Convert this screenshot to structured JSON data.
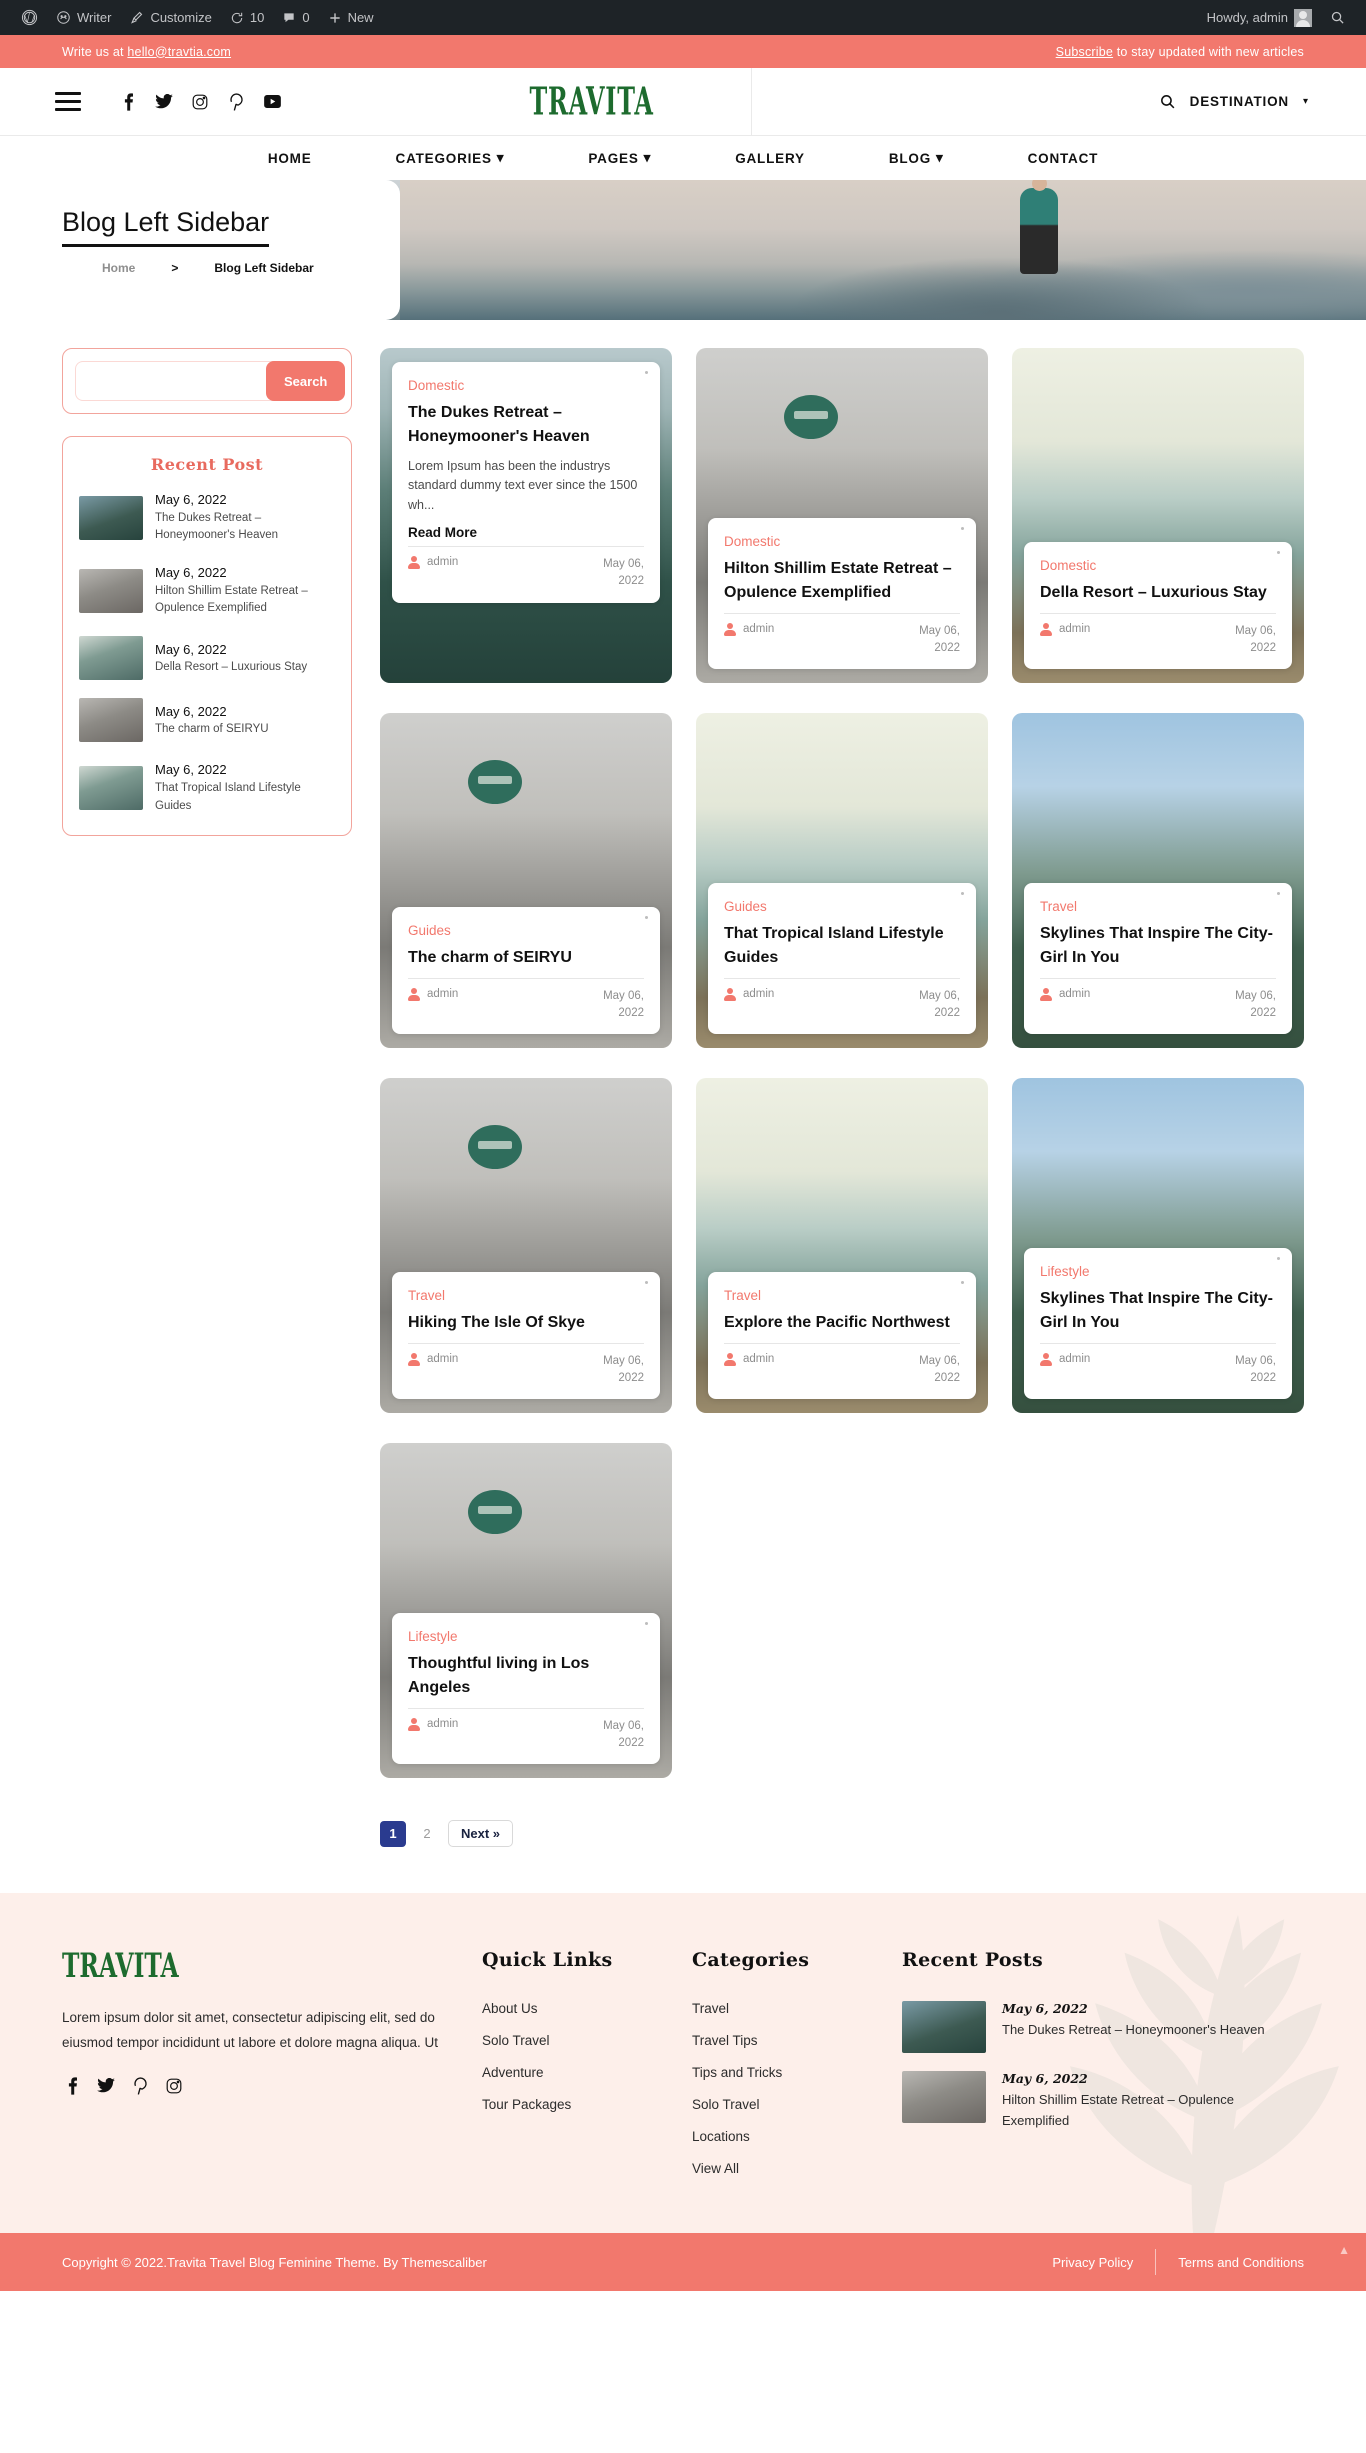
{
  "adminbar": {
    "items": [
      {
        "icon": "wordpress-icon",
        "label": ""
      },
      {
        "icon": "dashboard-icon",
        "label": "Writer"
      },
      {
        "icon": "brush-icon",
        "label": "Customize"
      },
      {
        "icon": "updates-icon",
        "label": "10"
      },
      {
        "icon": "comments-icon",
        "label": "0"
      },
      {
        "icon": "plus-icon",
        "label": "New"
      }
    ],
    "howdy": "Howdy, admin",
    "search_icon": "search-icon"
  },
  "notice": {
    "prefix": "Write us at ",
    "email": "hello@travtia.com",
    "subscribe_link": "Subscribe",
    "subscribe_rest": " to stay updated with new articles"
  },
  "header": {
    "menu_icon": "hamburger-icon",
    "socials": [
      "facebook-icon",
      "twitter-icon",
      "instagram-icon",
      "pinterest-icon",
      "youtube-icon"
    ],
    "brand": "Travita",
    "search_icon": "search-icon",
    "destination_label": "DESTINATION",
    "caret_icon": "chevron-down-icon"
  },
  "nav": [
    {
      "label": "HOME",
      "has_caret": false
    },
    {
      "label": "CATEGORIES",
      "has_caret": true
    },
    {
      "label": "PAGES",
      "has_caret": true
    },
    {
      "label": "GALLERY",
      "has_caret": false
    },
    {
      "label": "BLOG",
      "has_caret": true
    },
    {
      "label": "CONTACT",
      "has_caret": false
    }
  ],
  "hero": {
    "title": "Blog Left Sidebar",
    "breadcrumb_home": "Home",
    "breadcrumb_sep": ">",
    "breadcrumb_current": "Blog Left Sidebar"
  },
  "sidebar": {
    "search_placeholder": "",
    "search_value": "",
    "search_button": "Search",
    "recent_title": "Recent Post",
    "recent_posts": [
      {
        "date": "May 6, 2022",
        "title": "The Dukes Retreat – Honeymooner's Heaven",
        "thumb": "t1"
      },
      {
        "date": "May 6, 2022",
        "title": "Hilton Shillim Estate Retreat – Opulence Exemplified",
        "thumb": "t2"
      },
      {
        "date": "May 6, 2022",
        "title": "Della Resort – Luxurious Stay",
        "thumb": "t3"
      },
      {
        "date": "May 6, 2022",
        "title": "The charm of SEIRYU",
        "thumb": "t2"
      },
      {
        "date": "May 6, 2022",
        "title": "That Tropical Island Lifestyle Guides",
        "thumb": "t3"
      }
    ]
  },
  "posts": [
    {
      "category": "Domestic",
      "title": "The Dukes Retreat – Honeymooner's Heaven",
      "excerpt": "Lorem Ipsum has been the industrys standard dummy text ever since the 1500 wh...",
      "read_more": "Read More",
      "author": "admin",
      "date": "May 06, 2022",
      "image": "img-mountainlake",
      "sign": false
    },
    {
      "category": "Domestic",
      "title": "Hilton Shillim Estate Retreat – Opulence Exemplified",
      "excerpt": "",
      "read_more": "",
      "author": "admin",
      "date": "May 06, 2022",
      "image": "img-street",
      "sign": true
    },
    {
      "category": "Domestic",
      "title": "Della Resort – Luxurious Stay",
      "excerpt": "",
      "read_more": "",
      "author": "admin",
      "date": "May 06, 2022",
      "image": "img-snowmtn",
      "sign": false
    },
    {
      "category": "Guides",
      "title": "The charm of SEIRYU",
      "excerpt": "",
      "read_more": "",
      "author": "admin",
      "date": "May 06, 2022",
      "image": "img-street",
      "sign": true
    },
    {
      "category": "Guides",
      "title": "That Tropical Island Lifestyle Guides",
      "excerpt": "",
      "read_more": "",
      "author": "admin",
      "date": "May 06, 2022",
      "image": "img-snowmtn",
      "sign": false
    },
    {
      "category": "Travel",
      "title": "Skylines That Inspire The City-Girl In You",
      "excerpt": "",
      "read_more": "",
      "author": "admin",
      "date": "May 06, 2022",
      "image": "img-bluehill",
      "sign": false
    },
    {
      "category": "Travel",
      "title": "Hiking The Isle Of Skye",
      "excerpt": "",
      "read_more": "",
      "author": "admin",
      "date": "May 06, 2022",
      "image": "img-street",
      "sign": true
    },
    {
      "category": "Travel",
      "title": "Explore the Pacific Northwest",
      "excerpt": "",
      "read_more": "",
      "author": "admin",
      "date": "May 06, 2022",
      "image": "img-snowmtn",
      "sign": false
    },
    {
      "category": "Lifestyle",
      "title": "Skylines That Inspire The City-Girl In You",
      "excerpt": "",
      "read_more": "",
      "author": "admin",
      "date": "May 06, 2022",
      "image": "img-bluehill",
      "sign": false
    },
    {
      "category": "Lifestyle",
      "title": "Thoughtful living in Los Angeles",
      "excerpt": "",
      "read_more": "",
      "author": "admin",
      "date": "May 06, 2022",
      "image": "img-street",
      "sign": true
    }
  ],
  "pagination": {
    "current": "1",
    "next_page": "2",
    "next_label": "Next »"
  },
  "footer": {
    "logo": "Travita",
    "about": "Lorem ipsum dolor sit amet, consectetur adipiscing elit, sed do eiusmod tempor incididunt ut labore et dolore magna aliqua. Ut",
    "socials": [
      "facebook-icon",
      "twitter-icon",
      "pinterest-icon",
      "instagram-icon"
    ],
    "quick_links_title": "Quick Links",
    "quick_links": [
      "About Us",
      "Solo Travel",
      "Adventure",
      "Tour Packages"
    ],
    "categories_title": "Categories",
    "categories": [
      "Travel",
      "Travel Tips",
      "Tips and Tricks",
      "Solo Travel",
      "Locations",
      "View All"
    ],
    "recent_title": "Recent Posts",
    "recent_posts": [
      {
        "date": "May 6, 2022",
        "title": "The Dukes Retreat – Honeymooner's Heaven",
        "thumb": "t1"
      },
      {
        "date": "May 6, 2022",
        "title": "Hilton Shillim Estate Retreat – Opulence Exemplified",
        "thumb": "t2"
      }
    ]
  },
  "copyright": {
    "text": "Copyright © 2022.Travita Travel Blog Feminine Theme. By Themescaliber",
    "privacy": "Privacy Policy",
    "terms": "Terms and Conditions"
  },
  "colors": {
    "accent": "#f2786d",
    "brand_green": "#1d6b2e",
    "footer_bg": "#fdefea",
    "pagination_active": "#2a3b8f"
  }
}
